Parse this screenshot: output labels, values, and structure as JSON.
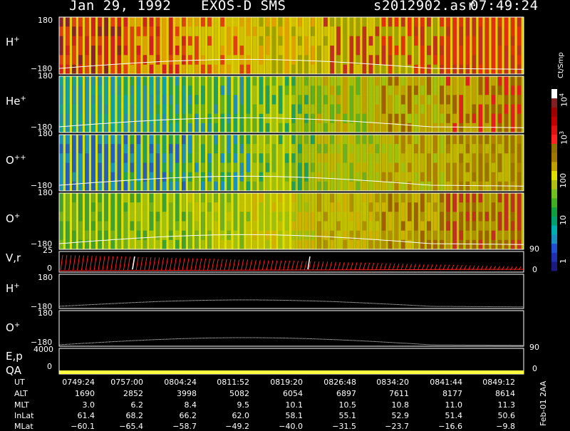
{
  "header": {
    "date": "Jan 29, 1992",
    "instrument": "EXOS-D SMS",
    "file": "s2012902.asr",
    "time": "07:49:24"
  },
  "colorbar": {
    "title": "Ct/Smp",
    "ticks": [
      "1",
      "10",
      "100",
      "10",
      "10"
    ],
    "exponents": [
      "",
      "",
      "",
      "3",
      "4"
    ],
    "colors": [
      "#1a1a80",
      "#2030b0",
      "#2050d0",
      "#1890c0",
      "#00b0b0",
      "#00a070",
      "#10a040",
      "#40b020",
      "#70c020",
      "#b0c010",
      "#e0e000",
      "#c0a000",
      "#a07800",
      "#907000",
      "#ff2020",
      "#e01010",
      "#c00000",
      "#a00000",
      "#802020",
      "#ffffff"
    ]
  },
  "panels": {
    "h_plus": {
      "species": "H",
      "charge": "+",
      "ymax": "180",
      "ymin": "−180"
    },
    "he_plus": {
      "species": "He",
      "charge": "+",
      "ymax": "180",
      "ymin": "−180"
    },
    "o_plusplus": {
      "species": "O",
      "charge": "++",
      "ymax": "180",
      "ymin": "−180"
    },
    "o_plus": {
      "species": "O",
      "charge": "+",
      "ymax": "180",
      "ymin": "−180"
    },
    "vr": {
      "label": "V,r",
      "ymax": "25",
      "ymin": "0",
      "rmax": "90",
      "rmin": "0"
    },
    "h_plus_line": {
      "species": "H",
      "charge": "+",
      "ymax": "180",
      "ymin": "−180"
    },
    "o_plus_line": {
      "species": "O",
      "charge": "+",
      "ymax": "180",
      "ymin": "−180"
    },
    "ep": {
      "label": "E,p",
      "ymax": "4000",
      "rmax": "90"
    },
    "qa": {
      "label": "QA",
      "ymin": "0",
      "rmin": "0"
    }
  },
  "chart_data": {
    "type": "heatmap",
    "title": "Jan 29, 1992   EXOS-D SMS",
    "x_times": [
      "07:49:24",
      "07:57:00",
      "08:04:24",
      "08:11:52",
      "08:19:20",
      "08:26:48",
      "08:34:20",
      "08:41:44",
      "08:49:12"
    ],
    "ylim_pitch": [
      -180,
      180
    ],
    "colorbar_range": [
      1,
      10000
    ],
    "colorbar_scale": "log",
    "series": [
      {
        "name": "H+",
        "panel": "spectrogram"
      },
      {
        "name": "He+",
        "panel": "spectrogram"
      },
      {
        "name": "O++",
        "panel": "spectrogram"
      },
      {
        "name": "O+",
        "panel": "spectrogram"
      }
    ]
  },
  "table": {
    "rows": [
      {
        "label": "UT",
        "values": [
          "0749:24",
          "0757:00",
          "0804:24",
          "0811:52",
          "0819:20",
          "0826:48",
          "0834:20",
          "0841:44",
          "0849:12"
        ]
      },
      {
        "label": "ALT",
        "values": [
          "1690",
          "2852",
          "3998",
          "5082",
          "6054",
          "6897",
          "7611",
          "8177",
          "8614"
        ]
      },
      {
        "label": "MLT",
        "values": [
          "3.0",
          "6.2",
          "8.4",
          "9.5",
          "10.1",
          "10.5",
          "10.8",
          "11.0",
          "11.3"
        ]
      },
      {
        "label": "InLat",
        "values": [
          "61.4",
          "68.2",
          "66.2",
          "62.0",
          "58.1",
          "55.1",
          "52.9",
          "51.4",
          "50.6"
        ]
      },
      {
        "label": "MLat",
        "values": [
          "−60.1",
          "−65.4",
          "−58.7",
          "−49.2",
          "−40.0",
          "−31.5",
          "−23.7",
          "−16.6",
          "−9.8"
        ]
      }
    ]
  },
  "side_note": "Feb-01 2AA"
}
